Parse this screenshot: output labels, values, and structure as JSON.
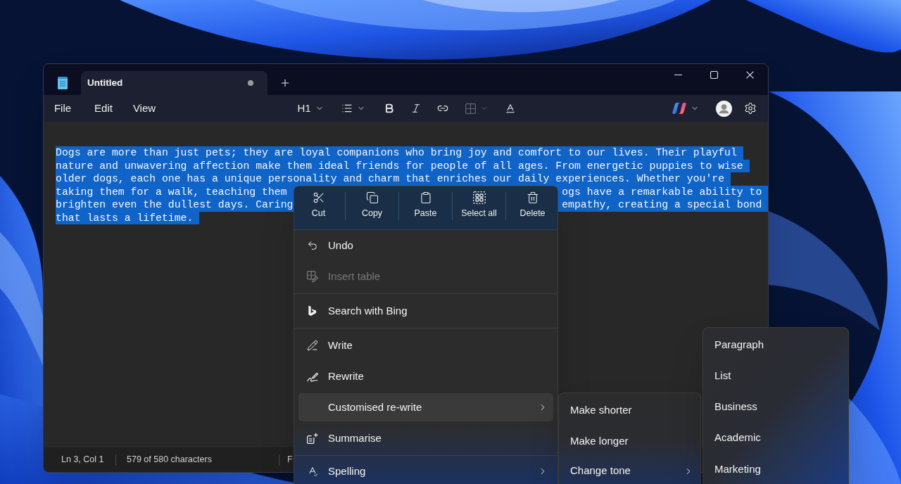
{
  "window": {
    "tab": {
      "title": "Untitled",
      "selected": true,
      "unsaved": true
    }
  },
  "menu_bar": [
    {
      "label": "File"
    },
    {
      "label": "Edit"
    },
    {
      "label": "View"
    }
  ],
  "toolbar": [
    {
      "kind": "heading",
      "label": "H1",
      "disabled": false
    },
    {
      "kind": "list",
      "disabled": false
    },
    {
      "kind": "bold",
      "disabled": false
    },
    {
      "kind": "italic",
      "disabled": false
    },
    {
      "kind": "link",
      "disabled": false
    },
    {
      "kind": "table",
      "disabled": true
    },
    {
      "kind": "spellcheck",
      "disabled": false
    }
  ],
  "document": {
    "selected": true,
    "lines": [
      [
        "Dogs are more than just pets; they are loyal companions who bring joy and comfort to our lives. Their playful"
      ],
      [
        "nature and unwavering affection make them ideal friends for people of all ages. From energetic puppies to wise"
      ],
      [
        "older dogs, each one has a unique personality and charm that enriches our daily experiences. Whether you're"
      ],
      [
        "taking them for a walk, teaching them",
        "ogs have a remarkable ability to"
      ],
      [
        "brighten even the dullest days. Caring",
        "empathy, creating a special bond"
      ],
      [
        "that lasts a lifetime."
      ]
    ]
  },
  "status_bar": [
    {
      "text": "Ln 3, Col 1"
    },
    {
      "text": "579 of 580 characters"
    },
    {
      "text": "F"
    }
  ],
  "context_menu": {
    "quick_actions": [
      {
        "kind": "cut",
        "label": "Cut"
      },
      {
        "kind": "copy",
        "label": "Copy"
      },
      {
        "kind": "paste",
        "label": "Paste"
      },
      {
        "kind": "select_all",
        "label": "Select all"
      },
      {
        "kind": "delete",
        "label": "Delete"
      }
    ],
    "groups": [
      [
        {
          "kind": "undo",
          "label": "Undo",
          "disabled": false,
          "selected": false,
          "submenu": false
        },
        {
          "kind": "insert_table",
          "label": "Insert table",
          "disabled": true,
          "selected": false,
          "submenu": false
        }
      ],
      [
        {
          "kind": "bing",
          "label": "Search with Bing",
          "disabled": false,
          "selected": false,
          "submenu": false
        }
      ],
      [
        {
          "kind": "write",
          "label": "Write",
          "disabled": false,
          "selected": false,
          "submenu": false
        },
        {
          "kind": "rewrite",
          "label": "Rewrite",
          "disabled": false,
          "selected": false,
          "submenu": false
        },
        {
          "kind": "plain",
          "label": "Customised re-write",
          "disabled": false,
          "selected": true,
          "submenu": true
        },
        {
          "kind": "summarise",
          "label": "Summarise",
          "disabled": false,
          "selected": false,
          "submenu": false
        }
      ],
      [
        {
          "kind": "spelling",
          "label": "Spelling",
          "disabled": false,
          "selected": false,
          "submenu": true
        }
      ]
    ]
  },
  "customised_rewrite_submenu": [
    {
      "label": "Make shorter",
      "selected": false,
      "submenu": false
    },
    {
      "label": "Make longer",
      "selected": false,
      "submenu": false
    },
    {
      "label": "Change tone",
      "selected": false,
      "submenu": true
    }
  ],
  "change_tone_submenu": [
    {
      "label": "Paragraph",
      "selected": false
    },
    {
      "label": "List",
      "selected": false
    },
    {
      "label": "Business",
      "selected": false
    },
    {
      "label": "Academic",
      "selected": false
    },
    {
      "label": "Marketing",
      "selected": false
    }
  ]
}
